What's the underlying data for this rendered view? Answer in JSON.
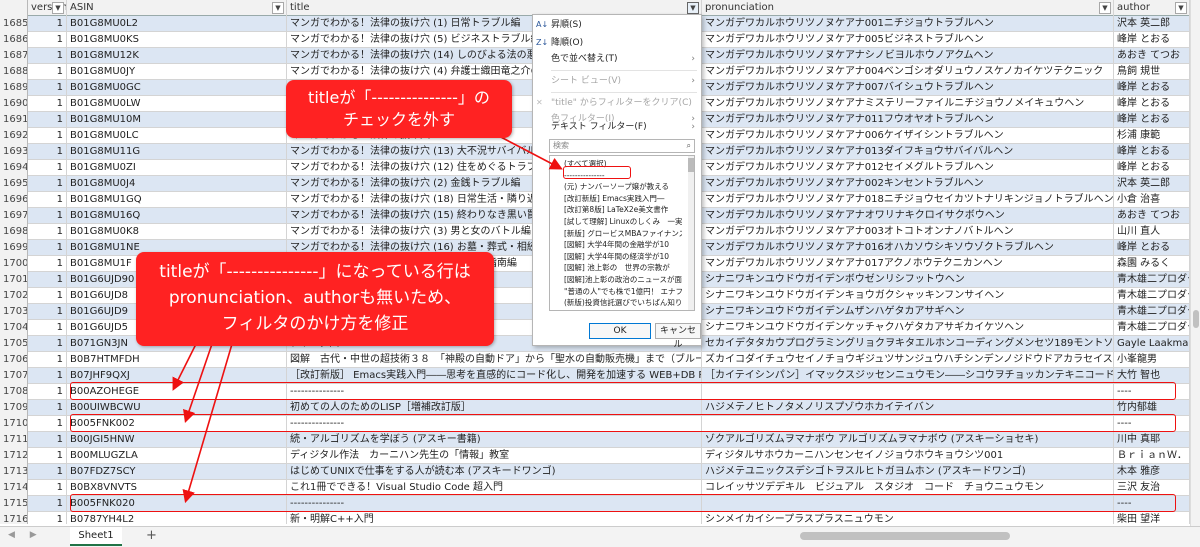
{
  "header": {
    "version": "version",
    "asin": "ASIN",
    "title": "title",
    "pronunciation": "pronunciation",
    "author": "author"
  },
  "rows": [
    {
      "n": "1685",
      "v": "1",
      "asin": "B01G8MU0L2",
      "title": "マンガでわかる！法律の抜け穴 (1) 日常トラブル編",
      "pron": "マンガデワカルホウリツノヌケアナ001ニチジョウトラブルヘン",
      "author": "沢本 英二郎"
    },
    {
      "n": "1686",
      "v": "1",
      "asin": "B01G8MU0KS",
      "title": "マンガでわかる！法律の抜け穴 (5) ビジネストラブル編",
      "pron": "マンガデワカルホウリツノヌケアナ005ビジネストラブルヘン",
      "author": "峰岸 とおる"
    },
    {
      "n": "1687",
      "v": "1",
      "asin": "B01G8MU12K",
      "title": "マンガでわかる！法律の抜け穴 (14) しのびよる法の悪夢",
      "pron": "マンガデワカルホウリツノヌケアナシノビヨルホウノアクムヘン",
      "author": "あおき てつお"
    },
    {
      "n": "1688",
      "v": "1",
      "asin": "B01G8MU0JY",
      "title": "マンガでわかる！法律の抜け穴 (4) 弁護士織田竜之介の",
      "pron": "マンガデワカルホウリツノヌケアナ004ベンゴシオダリュウノスケノカイケツテクニック",
      "author": "鳥飼 規世"
    },
    {
      "n": "1689",
      "v": "1",
      "asin": "B01G8MU0GC",
      "title": "マンガでわかる！法律の抜け穴",
      "pron": "マンガデワカルホウリツノヌケアナ007バイシュウトラブルヘン",
      "author": "峰岸 とおる"
    },
    {
      "n": "1690",
      "v": "1",
      "asin": "B01G8MU0LW",
      "title": "マンガでわかる！法律の抜け穴",
      "pron": "マンガデワカルホウリツノヌケアナミステリーファイルニチジョウノメイキュウヘン",
      "author": "峰岸 とおる"
    },
    {
      "n": "1691",
      "v": "1",
      "asin": "B01G8MU10M",
      "title": "マンガでわかる！法律の抜け穴",
      "pron": "マンガデワカルホウリツノヌケアナ011フウオヤオトラブルヘン",
      "author": "峰岸 とおる"
    },
    {
      "n": "1692",
      "v": "1",
      "asin": "B01G8MU0LC",
      "title": "マンガでわかる！法律の抜け穴",
      "pron": "マンガデワカルホウリツノヌケアナ006ケイザイシントラブルヘン",
      "author": "杉浦 康範"
    },
    {
      "n": "1693",
      "v": "1",
      "asin": "B01G8MU11G",
      "title": "マンガでわかる！法律の抜け穴 (13) 大不況サバイバル編",
      "pron": "マンガデワカルホウリツノヌケアナ013ダイフキョウサバイバルヘン",
      "author": "峰岸 とおる"
    },
    {
      "n": "1694",
      "v": "1",
      "asin": "B01G8MU0ZI",
      "title": "マンガでわかる！法律の抜け穴 (12) 住をめぐるトラブル",
      "pron": "マンガデワカルホウリツノヌケアナ012セイメグルトラブルヘン",
      "author": "峰岸 とおる"
    },
    {
      "n": "1695",
      "v": "1",
      "asin": "B01G8MU0J4",
      "title": "マンガでわかる！法律の抜け穴 (2) 金銭トラブル編",
      "pron": "マンガデワカルホウリツノヌケアナ002キンセントラブルヘン",
      "author": "沢本 英二郎"
    },
    {
      "n": "1696",
      "v": "1",
      "asin": "B01G8MU1GQ",
      "title": "マンガでわかる！法律の抜け穴 (18) 日常生活・隣り近所",
      "pron": "マンガデワカルホウリツノヌケアナ018ニチジョウセイカツトナリキンジョノトラブルヘン",
      "author": "小倉 治喜"
    },
    {
      "n": "1697",
      "v": "1",
      "asin": "B01G8MU16Q",
      "title": "マンガでわかる！法律の抜け穴 (15) 終わりなき黒い罠",
      "pron": "マンガデワカルホウリツノヌケアナオワリナキクロイサクボウヘン",
      "author": "あおき てつお"
    },
    {
      "n": "1698",
      "v": "1",
      "asin": "B01G8MU0K8",
      "title": "マンガでわかる！法律の抜け穴 (3) 男と女のバトル編",
      "pron": "マンガデワカルホウリツノヌケアナ003オトコトオンナノバトルヘン",
      "author": "山川 直人"
    },
    {
      "n": "1699",
      "v": "1",
      "asin": "B01G8MU1NE",
      "title": "マンガでわかる！法律の抜け穴 (16) お墓・葬式・相続",
      "pron": "マンガデワカルホウリツノヌケアナ016オハカソウシキソウゾクトラブルヘン",
      "author": "峰岸 とおる"
    },
    {
      "n": "1700",
      "v": "1",
      "asin": "B01G8MU1F",
      "title": "マンガでわかる！法律の抜け穴 (17) 子育て指南編",
      "pron": "マンガデワカルホウリツノヌケアナ017アクノホウテクニカンヘン",
      "author": "森園 みるく"
    },
    {
      "n": "1701",
      "v": "1",
      "asin": "B01G6UJD90",
      "title": "",
      "pron": "シナニワキンユウドウガイデンボウゼンリシフットウヘン",
      "author": "青木雄二プロダク"
    },
    {
      "n": "1702",
      "v": "1",
      "asin": "B01G6UJD8",
      "title": "",
      "pron": "シナニワキンユウドウガイデンキョウガクシャッキンフンサイヘン",
      "author": "青木雄二プロダク"
    },
    {
      "n": "1703",
      "v": "1",
      "asin": "B01G6UJD9",
      "title": "",
      "pron": "シナニワキンユウドウガイデンムザンハゲタカアサギヘン",
      "author": "青木雄二プロダク"
    },
    {
      "n": "1704",
      "v": "1",
      "asin": "B01G6UJD5",
      "title": "",
      "pron": "シナニワキンユウドウガイデンケッチャクハゲタカアサギカイケツヘン",
      "author": "青木雄二プロダク"
    },
    {
      "n": "1705",
      "v": "1",
      "asin": "B071GN3JN",
      "title": "ディング図",
      "pron": "セカイデタタカウプログラミングリョクヲキタエルホンコーディングメンセツ189モントソノカイホウ",
      "author": "Gayle Laakmann"
    },
    {
      "n": "1706",
      "v": "1",
      "asin": "B0B7HTMFDH",
      "title": "図解　古代・中世の超技術３８　「神殿の自動ドア」から「聖水の自動販売機」まで（ブルーバ",
      "pron": "ズカイコダイチュウセイノチョウギジュツサンジュウハチシンデンノジドウドアカラセイスイノ",
      "author": "小峯龍男"
    },
    {
      "n": "1707",
      "v": "1",
      "asin": "B07JHF9QXJ",
      "title": "［改訂新版］ Emacs実践入門――思考を直感的にコード化し、開発を加速する WEB+DB PRESS",
      "pron": "［カイテイシンパン］イマックスジッセンニュウモン――シコウヲチョッカンテキニコードカシ",
      "author": "大竹 智也"
    },
    {
      "n": "1708",
      "v": "1",
      "asin": "B00AZOHEGE",
      "title": "---------------",
      "pron": "",
      "author": "----"
    },
    {
      "n": "1709",
      "v": "1",
      "asin": "B00UIWBCWU",
      "title": "初めての人のためのLISP［増補改訂版］",
      "pron": "ハジメテノヒトノタメノリスプゾウホカイテイバン",
      "author": "竹内郁雄"
    },
    {
      "n": "1710",
      "v": "1",
      "asin": "B005FNK002",
      "title": "---------------",
      "pron": "",
      "author": "----"
    },
    {
      "n": "1711",
      "v": "1",
      "asin": "B00JGI5HNW",
      "title": "続・アルゴリズムを学ぼう (アスキー書籍)",
      "pron": "ゾクアルゴリズムヲマナボウ アルゴリズムヲマナボウ (アスキーショセキ)",
      "author": "川中 真耶"
    },
    {
      "n": "1712",
      "v": "1",
      "asin": "B00MLUGZLA",
      "title": "ディジタル作法　カーニハン先生の「情報」教室",
      "pron": "ディジタルサホウカーニハンセンセイノジョウホウキョウシツ001",
      "author": "ＢｒｉａｎＷ．"
    },
    {
      "n": "1713",
      "v": "1",
      "asin": "B07FDZ7SCY",
      "title": "はじめてUNIXで仕事をする人が読む本 (アスキードワンゴ)",
      "pron": "ハジメテユニックスデシゴトヲスルヒトガヨムホン (アスキードワンゴ)",
      "author": "木本 雅彦"
    },
    {
      "n": "1714",
      "v": "1",
      "asin": "B0BX8VNVTS",
      "title": "これ1冊でできる！Visual Studio Code 超入門",
      "pron": "コレイッサツデデキル　ビジュアル　スタジオ　コード　チョウニュウモン",
      "author": "三沢 友治"
    },
    {
      "n": "1715",
      "v": "1",
      "asin": "B005FNK020",
      "title": "---------------",
      "pron": "",
      "author": "----"
    },
    {
      "n": "1716",
      "v": "1",
      "asin": "B0787YH4L2",
      "title": "新・明解C++入門",
      "pron": "シンメイカイシープラスプラスニュウモン",
      "author": "柴田 望洋"
    }
  ],
  "filter_menu": {
    "sort_asc": "昇順(S)",
    "sort_desc": "降順(O)",
    "sort_by_color": "色で並べ替え(T)",
    "sheet_view": "シート ビュー(V)",
    "clear_filter": "\"title\" からフィルターをクリア(C)",
    "color_filter": "色フィルター(I)",
    "text_filter": "テキスト フィルター(F)",
    "search_placeholder": "検索",
    "list": [
      {
        "label": "(すべて選択)",
        "checked": "■"
      },
      {
        "label": "---------------",
        "checked": ""
      },
      {
        "label": "(元) ナンバーソープ嬢が教える",
        "checked": "✓"
      },
      {
        "label": "[改訂新版] Emacs実践入門―",
        "checked": "✓"
      },
      {
        "label": "[改訂第8版] LaTeX2e美文書作",
        "checked": "✓"
      },
      {
        "label": "[試して理解] Linuxのしくみ　一実",
        "checked": "✓"
      },
      {
        "label": "[新版] グロービスMBAファイナンス",
        "checked": "✓"
      },
      {
        "label": "[図解] 大学4年間の金融学が10",
        "checked": "✓"
      },
      {
        "label": "[図解] 大学4年間の経済学が10",
        "checked": "✓"
      },
      {
        "label": "[図解] 池上彰の　世界の宗教が",
        "checked": "✓"
      },
      {
        "label": "[図解]池上彰の政治のニュースが面",
        "checked": "✓"
      },
      {
        "label": "\"普通の人\"でも株で1億円！ エナフ",
        "checked": "✓"
      },
      {
        "label": "(新版)投資信託選びでいちばん知り",
        "checked": "✓"
      }
    ],
    "ok_label": "OK",
    "cancel_label": "キャンセル"
  },
  "callouts": {
    "c1_line1": "titleが「---------------」の",
    "c1_line2": "チェックを外す",
    "c2_line1": "titleが「---------------」になっている行は",
    "c2_line2": "pronunciation、authorも無いため、",
    "c2_line3": "フィルタのかけ方を修正"
  },
  "tabs": {
    "sheet": "Sheet1",
    "add": "+"
  },
  "colors": {
    "callout": "#ff2222",
    "band": "#dce6f3",
    "highlight": "#e11111"
  }
}
